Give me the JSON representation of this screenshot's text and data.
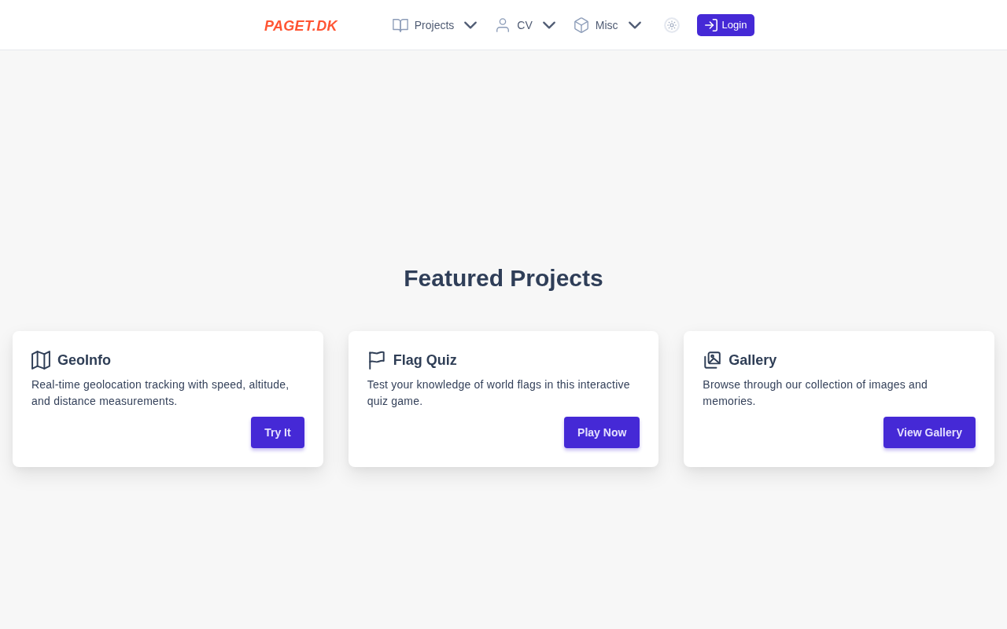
{
  "header": {
    "logo": "PAGET.DK",
    "nav": [
      {
        "kind": "book",
        "label": "Projects"
      },
      {
        "kind": "user",
        "label": "CV"
      },
      {
        "kind": "cube",
        "label": "Misc"
      }
    ],
    "theme_toggle": {
      "on": false
    },
    "login_button": "Login"
  },
  "featured": {
    "title": "Featured Projects",
    "cards": [
      {
        "kind": "map",
        "title": "GeoInfo",
        "description": "Real-time geolocation tracking with speed, altitude, and distance measurements.",
        "button": "Try It"
      },
      {
        "kind": "flag",
        "title": "Flag Quiz",
        "description": "Test your knowledge of world flags in this interactive quiz game.",
        "button": "Play Now"
      },
      {
        "kind": "images",
        "title": "Gallery",
        "description": "Browse through our collection of images and memories.",
        "button": "View Gallery"
      }
    ]
  }
}
